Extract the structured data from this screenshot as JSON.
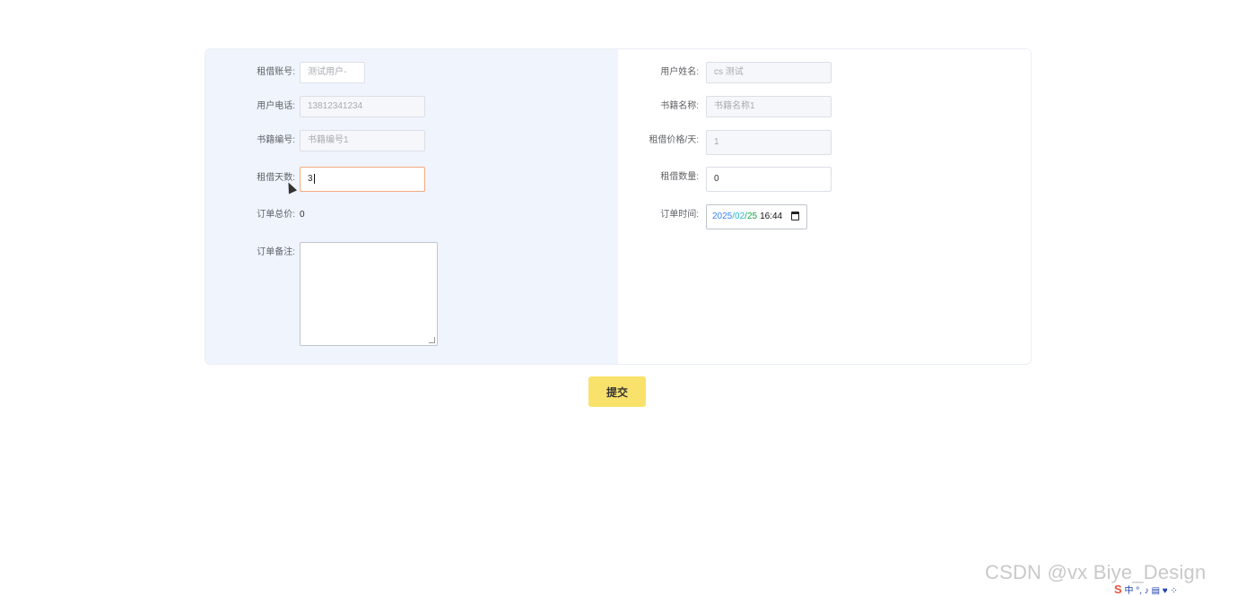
{
  "form": {
    "left": {
      "account": {
        "label": "租借账号:",
        "value": "测试用户-"
      },
      "phone": {
        "label": "用户电话:",
        "value": "13812341234"
      },
      "book_no": {
        "label": "书籍编号:",
        "value": "书籍编号1"
      },
      "days": {
        "label": "租借天数:",
        "value": "3"
      },
      "total": {
        "label": "订单总价:",
        "value": "0"
      },
      "remark": {
        "label": "订单备注:",
        "value": ""
      }
    },
    "right": {
      "username": {
        "label": "用户姓名:",
        "value": "cs 测试"
      },
      "book_name": {
        "label": "书籍名称:",
        "value": "书籍名称1"
      },
      "price": {
        "label": "租借价格/天:",
        "value": "1"
      },
      "quantity": {
        "label": "租借数量:",
        "value": "0"
      },
      "order_time": {
        "label": "订单时间:",
        "year": "2025",
        "sep1": "/",
        "month": "02",
        "sep2": "/",
        "day": "25",
        "time": "16:44"
      }
    }
  },
  "submit_label": "提交",
  "watermark": "CSDN @vx Biye_Design",
  "tray": {
    "logo": "S",
    "text": "中 °, ♪ ▤ ♥ ⁘"
  },
  "colors": {
    "left_bg": "#eff4fd",
    "submit_bg": "#f9e26b",
    "focus_border": "#f5a97f"
  }
}
